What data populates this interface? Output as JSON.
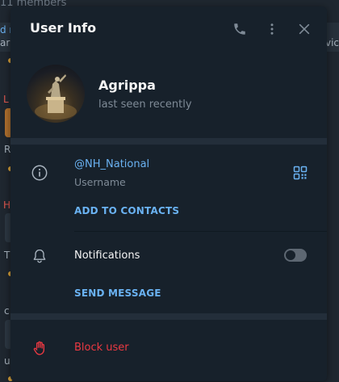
{
  "background": {
    "members_text": "11 members",
    "fragments": [
      "d n",
      "ar",
      "vice",
      "L",
      "R",
      "H",
      "T",
      "c",
      "u"
    ]
  },
  "dialog": {
    "title": "User Info",
    "header_icons": [
      "phone-icon",
      "more-vertical-icon",
      "close-icon"
    ]
  },
  "profile": {
    "name": "Agrippa",
    "status": "last seen recently"
  },
  "info": {
    "username": "@NH_National",
    "username_label": "Username",
    "add_contacts": "ADD TO CONTACTS"
  },
  "notifications": {
    "label": "Notifications",
    "enabled": false,
    "send_message": "SEND MESSAGE"
  },
  "block": {
    "label": "Block user"
  },
  "colors": {
    "dialog_bg": "#17212b",
    "accent": "#6ab2f2",
    "danger": "#ec3942",
    "muted": "#7f8b97",
    "text": "#f5f5f5"
  }
}
